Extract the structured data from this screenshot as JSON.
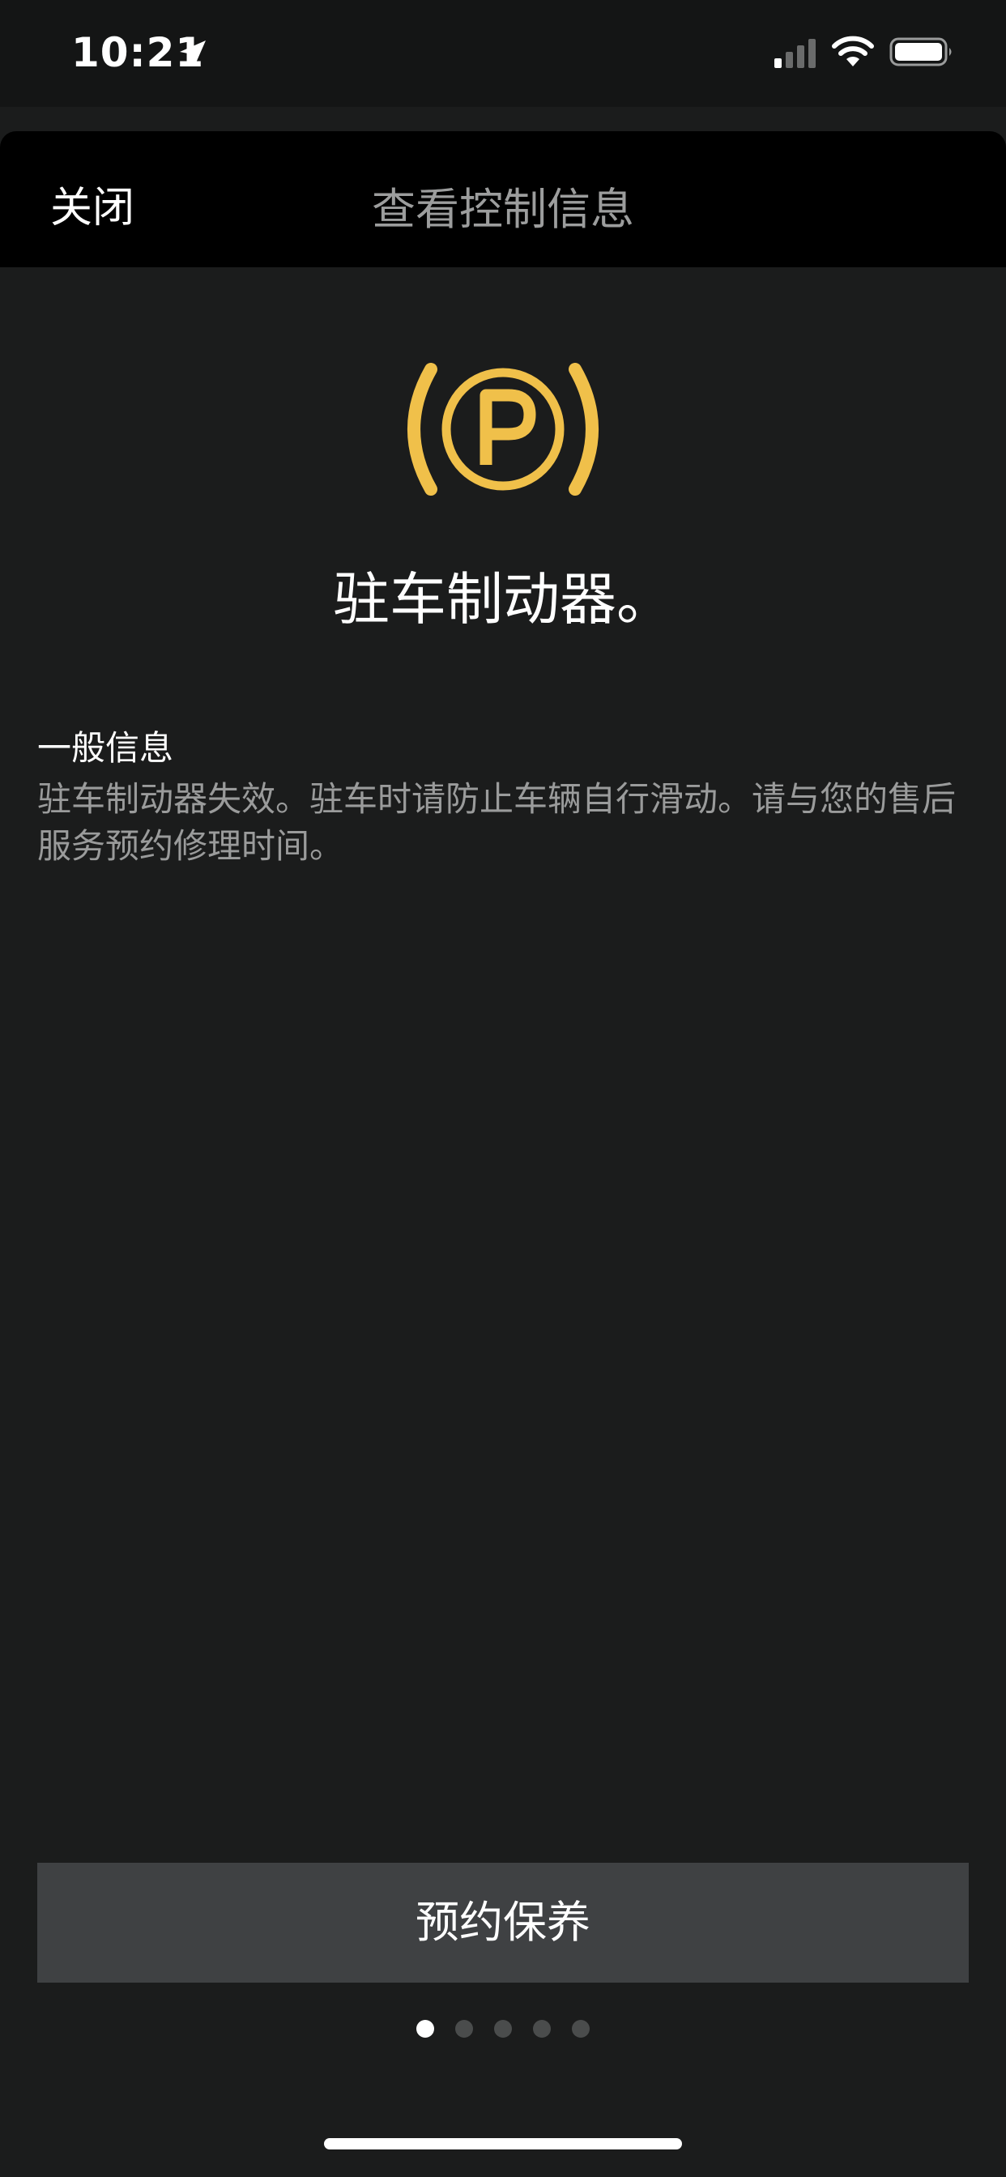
{
  "status_bar": {
    "time": "10:21"
  },
  "nav": {
    "close_label": "关闭",
    "title": "查看控制信息"
  },
  "warning": {
    "icon": "parking-brake-icon",
    "icon_color": "#f0c04a",
    "title": "驻车制动器。"
  },
  "info": {
    "heading": "一般信息",
    "body": "驻车制动器失效。驻车时请防止车辆自行滑动。请与您的售后服务预约修理时间。"
  },
  "actions": {
    "book_service_label": "预约保养"
  },
  "pagination": {
    "total_pages": 5,
    "current_page": 1
  },
  "colors": {
    "background": "#1b1c1c",
    "nav_background": "#000000",
    "accent_yellow": "#f0c04a",
    "button_background": "#3f4143"
  }
}
